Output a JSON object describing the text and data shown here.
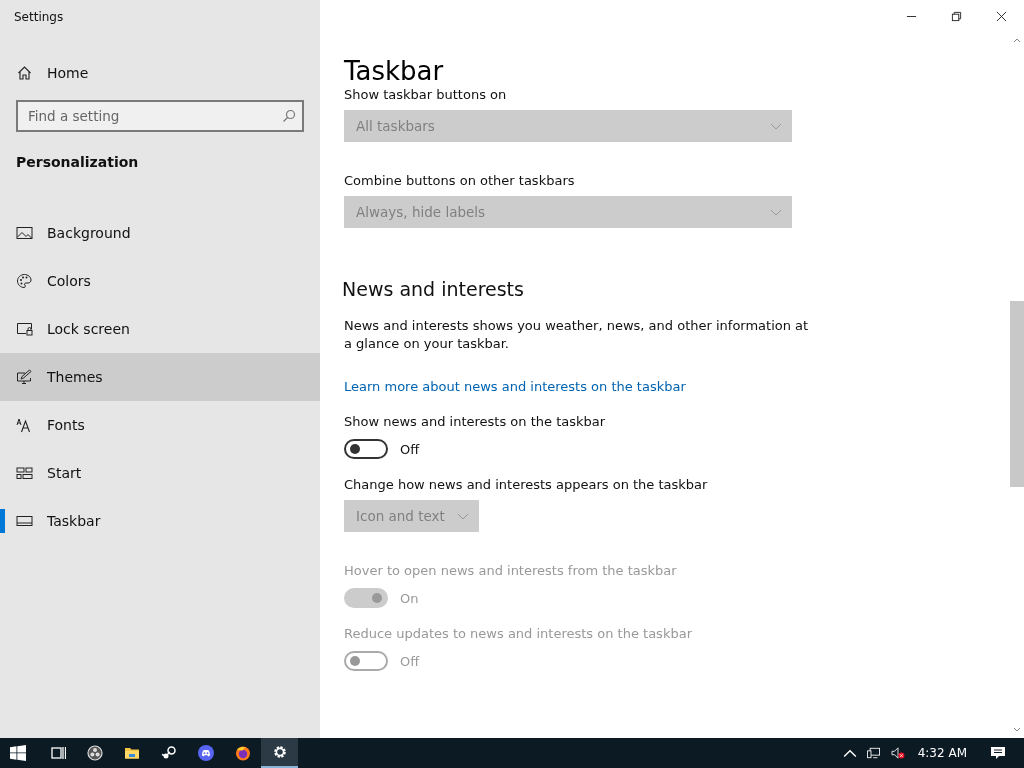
{
  "window": {
    "title": "Settings"
  },
  "sidebar": {
    "home": "Home",
    "search": {
      "placeholder": "Find a setting"
    },
    "section": "Personalization",
    "items": [
      {
        "label": "Background",
        "selected": false,
        "hover": false
      },
      {
        "label": "Colors",
        "selected": false,
        "hover": false
      },
      {
        "label": "Lock screen",
        "selected": false,
        "hover": false
      },
      {
        "label": "Themes",
        "selected": false,
        "hover": true
      },
      {
        "label": "Fonts",
        "selected": false,
        "hover": false
      },
      {
        "label": "Start",
        "selected": false,
        "hover": false
      },
      {
        "label": "Taskbar",
        "selected": true,
        "hover": false
      }
    ]
  },
  "page": {
    "title": "Taskbar",
    "settings": [
      {
        "kind": "label",
        "text": "Show taskbar buttons on",
        "disabled": false
      },
      {
        "kind": "dropdown",
        "value": "All taskbars",
        "wide": true,
        "disabled": true
      },
      {
        "kind": "label",
        "text": "Combine buttons on other taskbars",
        "disabled": false
      },
      {
        "kind": "dropdown",
        "value": "Always, hide labels",
        "wide": true,
        "disabled": true
      },
      {
        "kind": "heading",
        "text": "News and interests"
      },
      {
        "kind": "paragraph",
        "text": "News and interests shows you weather, news, and other information at a glance on your taskbar."
      },
      {
        "kind": "link",
        "text": "Learn more about news and interests on the taskbar"
      },
      {
        "kind": "label",
        "text": "Show news and interests on the taskbar",
        "disabled": false
      },
      {
        "kind": "toggle",
        "on": false,
        "state": "Off",
        "disabled": false
      },
      {
        "kind": "label",
        "text": "Change how news and interests appears on the taskbar",
        "disabled": false
      },
      {
        "kind": "dropdown",
        "value": "Icon and text",
        "wide": false,
        "disabled": true
      },
      {
        "kind": "label",
        "text": "Hover to open news and interests from the taskbar",
        "disabled": true
      },
      {
        "kind": "toggle",
        "on": true,
        "state": "On",
        "disabled": true
      },
      {
        "kind": "label",
        "text": "Reduce updates to news and interests on the taskbar",
        "disabled": true
      },
      {
        "kind": "toggle",
        "on": false,
        "state": "Off",
        "disabled": true
      }
    ]
  },
  "taskbar": {
    "apps": [
      {
        "active": false
      },
      {
        "active": false
      },
      {
        "active": false
      },
      {
        "active": false
      },
      {
        "active": false
      },
      {
        "active": false
      },
      {
        "active": true
      }
    ],
    "clock": "4:32 AM"
  }
}
